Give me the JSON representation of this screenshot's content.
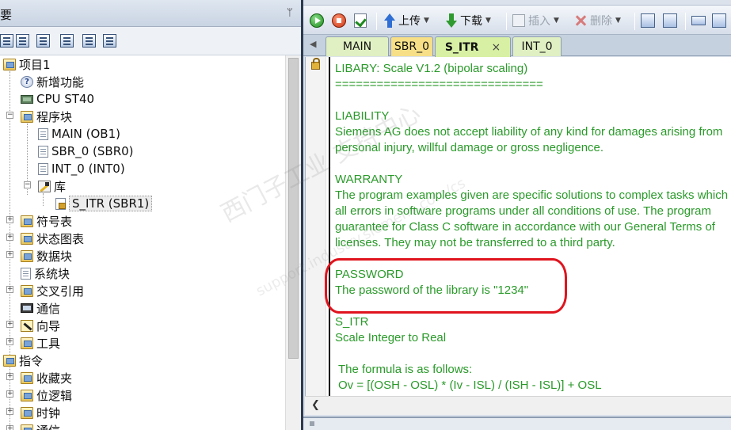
{
  "left_panel": {
    "title": "要",
    "pin": "ᛘ",
    "tree": {
      "project": "项目1",
      "new_features": "新增功能",
      "cpu": "CPU ST40",
      "program_block": "程序块",
      "main": "MAIN (OB1)",
      "sbr0": "SBR_0 (SBR0)",
      "int0": "INT_0 (INT0)",
      "library": "库",
      "s_itr": "S_ITR (SBR1)",
      "symbol_table": "符号表",
      "status_chart": "状态图表",
      "data_block": "数据块",
      "system_block": "系统块",
      "cross_ref": "交叉引用",
      "communication": "通信",
      "wizard": "向导",
      "tools": "工具",
      "instructions": "指令",
      "favorites": "收藏夹",
      "bit_logic": "位逻辑",
      "clock": "时钟",
      "communication2": "通信"
    }
  },
  "toolbar": {
    "upload": "上传",
    "download": "下载",
    "insert": "插入",
    "delete": "删除"
  },
  "tabs": {
    "main": "MAIN",
    "sbr0": "SBR_0",
    "s_itr": "S_ITR",
    "int0": "INT_0",
    "close": "×"
  },
  "editor": {
    "lines": [
      "LIBARY: Scale V1.2 (bipolar scaling)",
      "==============================",
      "LIABILITY",
      "Siemens AG does not accept liability of any kind for damages arising from",
      "personal injury, willful damage or gross negligence.",
      "WARRANTY",
      "The program examples given are specific solutions to complex tasks which",
      "all errors in software programs under all conditions of use. The program",
      "guarantee for Class C software in accordance with our General Terms of",
      "licenses. They may not be transferred to a third party.",
      "PASSWORD",
      "The password of the library is \"1234\"",
      "S_ITR",
      "Scale Integer to Real",
      "The formula is as follows:",
      "Ov = [(OSH - OSL) * (Iv - ISL) / (ISH - ISL)] + OSL"
    ]
  },
  "watermark": {
    "text1": "西门子工业 支持中心",
    "text2": "support.industry.siemens.com/cs"
  },
  "colors": {
    "code_green": "#2a9a2a",
    "highlight_red": "#e0141e"
  }
}
